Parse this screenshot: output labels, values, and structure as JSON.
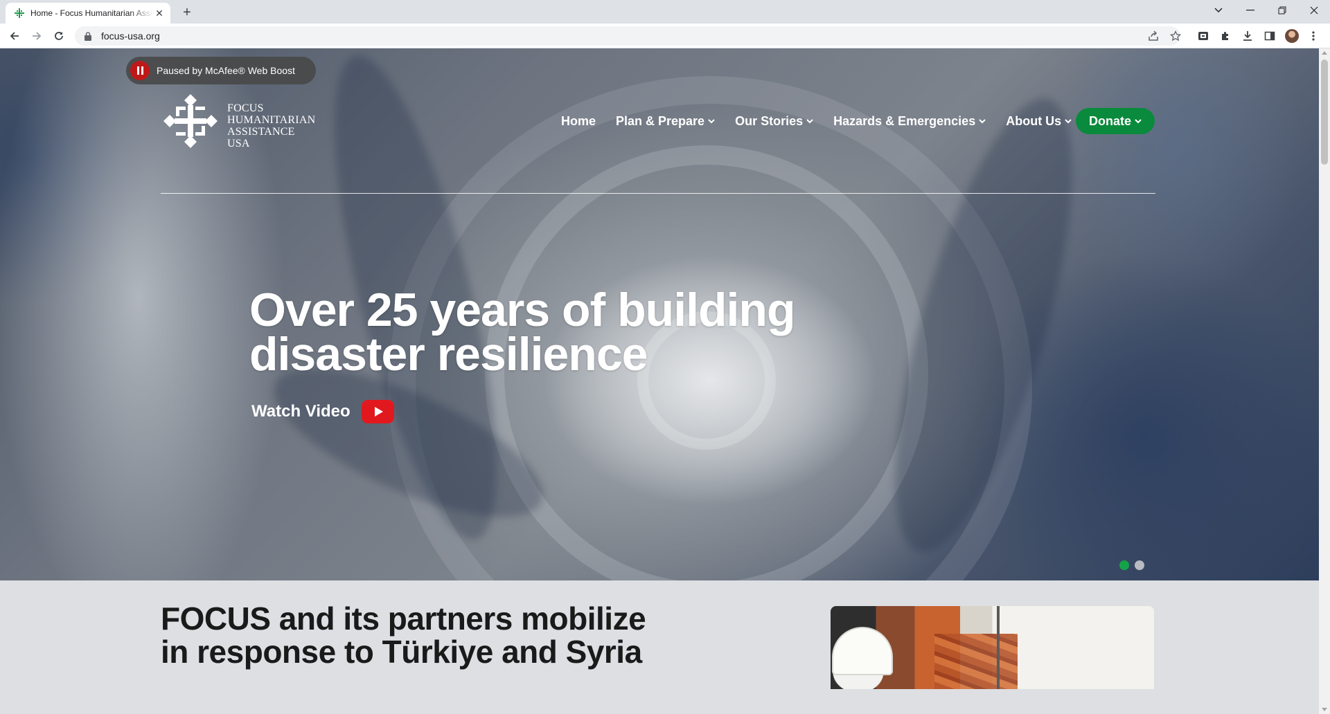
{
  "browser": {
    "tab_title": "Home - Focus Humanitarian Assistance USA",
    "url": "focus-usa.org",
    "icons": {
      "favicon": "focus-favicon",
      "tab_close": "close-icon",
      "new_tab": "plus-icon",
      "tab_search": "chevron-down-icon",
      "minimize": "minimize-icon",
      "restore": "restore-icon",
      "close_window": "close-icon",
      "back": "arrow-left-icon",
      "forward": "arrow-right-icon",
      "reload": "reload-icon",
      "lock": "lock-icon",
      "share": "share-icon",
      "bookmark": "star-icon",
      "extension_mcafee": "mcafee-extension-icon",
      "extensions": "puzzle-icon",
      "downloads": "download-icon",
      "side_panel": "side-panel-icon",
      "profile": "avatar",
      "menu": "kebab-menu-icon"
    }
  },
  "mcafee": {
    "label": "Paused by McAfee® Web Boost"
  },
  "site": {
    "logo": {
      "lines": [
        "FOCUS",
        "HUMANITARIAN",
        "ASSISTANCE",
        "USA"
      ]
    },
    "nav": [
      {
        "label": "Home",
        "has_dropdown": false
      },
      {
        "label": "Plan & Prepare",
        "has_dropdown": true
      },
      {
        "label": "Our Stories",
        "has_dropdown": true
      },
      {
        "label": "Hazards & Emergencies",
        "has_dropdown": true
      },
      {
        "label": "About Us",
        "has_dropdown": true
      }
    ],
    "donate_label": "Donate",
    "colors": {
      "donate_green": "#0a8a3c",
      "active_dot": "#15a34a",
      "video_red": "#e1191f"
    }
  },
  "hero": {
    "title_line1": "Over 25 years of building",
    "title_line2": "disaster resilience",
    "watch_label": "Watch Video",
    "carousel": {
      "slides": 2,
      "active_index": 1
    }
  },
  "section": {
    "title_line1": "FOCUS and its partners mobilize",
    "title_line2": "in response to Türkiye and Syria"
  }
}
